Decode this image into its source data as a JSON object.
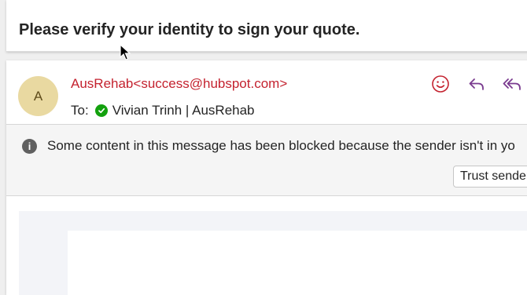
{
  "subject": "Please verify your identity to sign your quote.",
  "message": {
    "avatar_initial": "A",
    "sender": "AusRehab<success@hubspot.com>",
    "to_label": "To:",
    "recipient": "Vivian Trinh | AusRehab",
    "toolbar": {
      "icons": [
        "smiley-icon",
        "reply-icon",
        "reply-all-icon"
      ]
    }
  },
  "banner": {
    "text": "Some content in this message has been blocked because the sender isn't in yo",
    "trust_button": "Trust sender"
  },
  "colors": {
    "sender": "#c4222f",
    "avatar_bg": "#e9d9a1",
    "verified_green": "#13a10e",
    "toolbar_icon": "#c4222f",
    "reply_all_icon": "#7a3b8f"
  }
}
